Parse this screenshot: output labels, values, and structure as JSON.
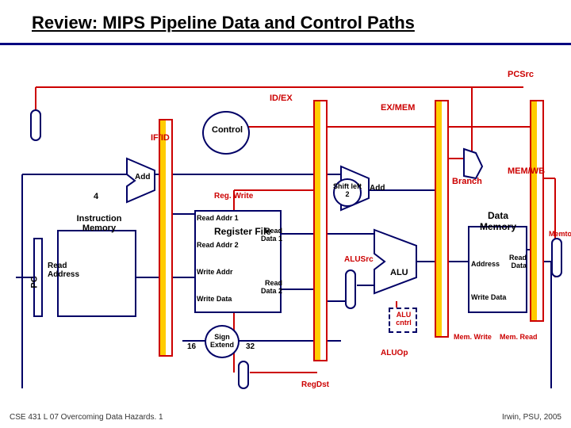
{
  "title": "Review: MIPS Pipeline Data and Control Paths",
  "signals": {
    "pcsrc": "PCSrc",
    "idex": "ID/EX",
    "exmem": "EX/MEM",
    "ifid": "IF/ID",
    "memwb": "MEM/WB",
    "control": "Control",
    "branch": "Branch",
    "regwrite": "Reg. Write",
    "alusrc": "ALUSrc",
    "alucntrl": "ALU cntrl",
    "aluop": "ALUOp",
    "regdst": "RegDst",
    "memtoreg": "Memto. Reg",
    "memwrite": "Mem. Write",
    "memread": "Mem. Read"
  },
  "blocks": {
    "add1": "Add",
    "add2": "Add",
    "four": "4",
    "instrmem": "Instruction Memory",
    "pc": "PC",
    "readaddr": "Read Address",
    "regfile": "Register File",
    "readaddr1": "Read Addr 1",
    "readaddr2": "Read Addr 2",
    "writeaddr": "Write Addr",
    "writedata": "Write Data",
    "readdata1": "Read Data 1",
    "readdata2": "Read Data 2",
    "shiftleft2": "Shift left 2",
    "alu": "ALU",
    "datamem": "Data Memory",
    "dmaddress": "Address",
    "dmreaddata": "Read Data",
    "dmwritedata": "Write Data",
    "signextend": "Sign Extend",
    "n16": "16",
    "n32": "32"
  },
  "footer": {
    "left": "CSE 431  L 07 Overcoming Data Hazards. 1",
    "right": "Irwin, PSU, 2005"
  }
}
